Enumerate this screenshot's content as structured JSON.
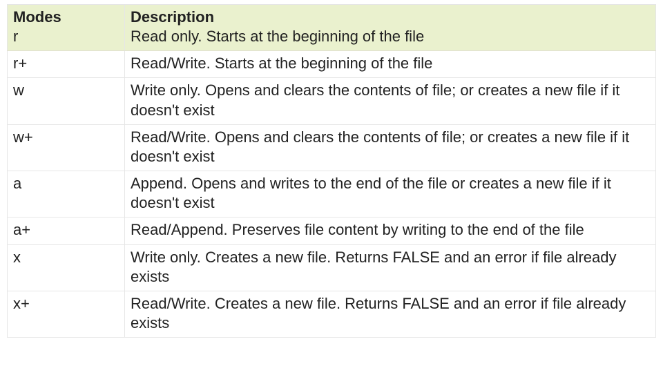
{
  "chart_data": {
    "type": "table",
    "title": "",
    "columns": [
      "Modes",
      "Description"
    ],
    "header_example": {
      "mode": "r",
      "description": "Read only. Starts at the beginning of the file"
    },
    "rows": [
      {
        "mode": "r+",
        "description": "Read/Write. Starts at the beginning of the file"
      },
      {
        "mode": "w",
        "description": "Write only. Opens and clears the contents of file; or creates a new file if it doesn't exist"
      },
      {
        "mode": "w+",
        "description": "Read/Write. Opens and clears the contents of file; or creates a new file if it doesn't exist"
      },
      {
        "mode": "a",
        "description": "Append. Opens and writes to the end of the file or creates a new file if it doesn't exist"
      },
      {
        "mode": "a+",
        "description": "Read/Append. Preserves file content by writing to the end of the file"
      },
      {
        "mode": "x",
        "description": "Write only. Creates a new file. Returns FALSE and an error if file already exists"
      },
      {
        "mode": "x+",
        "description": "Read/Write. Creates a new file. Returns FALSE and an error if file already exists"
      }
    ]
  }
}
